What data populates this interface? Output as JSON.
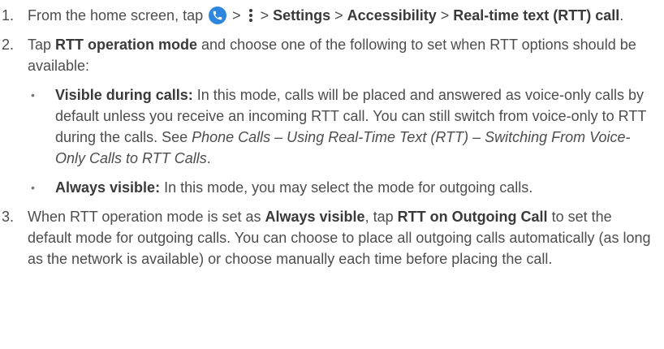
{
  "steps": [
    {
      "num": "1.",
      "text_a": "From the home screen, tap ",
      "sep1": " > ",
      "sep2": " > ",
      "settings": "Settings",
      "sep3": " > ",
      "accessibility": "Accessibility",
      "sep4": " > ",
      "rtt_call": "Real-time text (RTT) call",
      "end": "."
    },
    {
      "num": "2.",
      "text_a": "Tap ",
      "bold_a": "RTT operation mode",
      "text_b": " and choose one of the following to set when RTT options should be available:",
      "bullets": [
        {
          "mark": "•",
          "title": "Visible during calls:",
          "text": " In this mode, calls will be placed and answered as voice-only calls by default unless you receive an incoming RTT call. You can still switch from voice-only to RTT during the calls. See ",
          "ref": "Phone Calls – Using Real-Time Text (RTT) – Switching From Voice-Only Calls to RTT Calls",
          "end": "."
        },
        {
          "mark": "•",
          "title": "Always visible:",
          "text": " In  this mode, you may select the mode for outgoing calls."
        }
      ]
    },
    {
      "num": "3.",
      "text_a": "When RTT operation mode is set as ",
      "bold_a": "Always visible",
      "text_b": ", tap ",
      "bold_b": "RTT on Outgoing Call",
      "text_c": " to set the default mode for outgoing calls. You can choose to place all outgoing calls automatically (as long as the network is available) or choose manually each time before placing the call."
    }
  ],
  "icons": {
    "phone": "phone-icon",
    "more": "more-vertical-icon",
    "phone_color": "#2e86de"
  }
}
